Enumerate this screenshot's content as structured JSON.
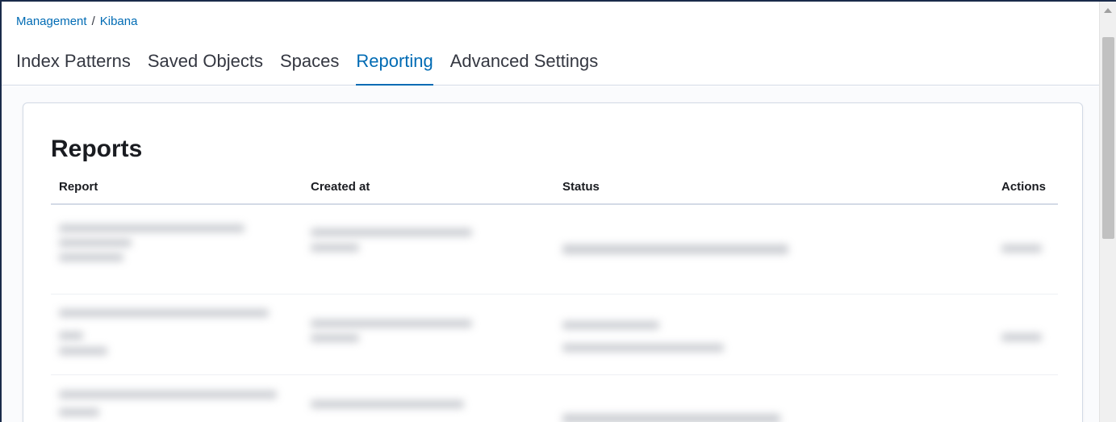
{
  "breadcrumb": {
    "parent": "Management",
    "separator": "/",
    "current": "Kibana"
  },
  "tabs": [
    {
      "label": "Index Patterns"
    },
    {
      "label": "Saved Objects"
    },
    {
      "label": "Spaces"
    },
    {
      "label": "Reporting",
      "active": true
    },
    {
      "label": "Advanced Settings"
    }
  ],
  "reports": {
    "title": "Reports",
    "columns": {
      "report": "Report",
      "created_at": "Created at",
      "status": "Status",
      "actions": "Actions"
    }
  },
  "colors": {
    "accent": "#006bb4",
    "text": "#343741",
    "border": "#d3dae6"
  }
}
